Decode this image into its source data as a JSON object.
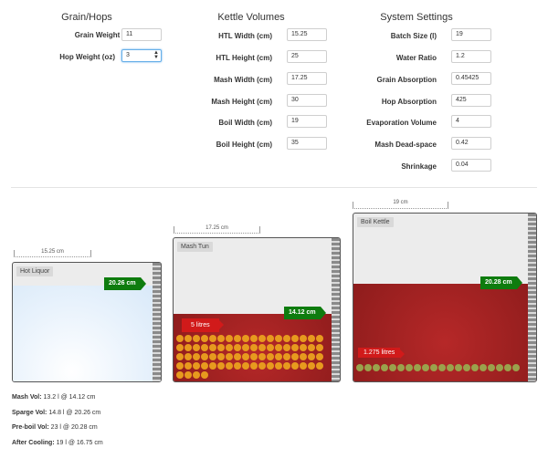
{
  "grain_hops": {
    "title": "Grain/Hops",
    "fields": [
      {
        "label": "Grain Weight (lb)",
        "value": "11"
      },
      {
        "label": "Hop Weight (oz)",
        "value": "3"
      }
    ]
  },
  "kettle_volumes": {
    "title": "Kettle Volumes",
    "fields": [
      {
        "label": "HTL Width (cm)",
        "value": "15.25"
      },
      {
        "label": "HTL Height (cm)",
        "value": "25"
      },
      {
        "label": "Mash Width (cm)",
        "value": "17.25"
      },
      {
        "label": "Mash Height (cm)",
        "value": "30"
      },
      {
        "label": "Boil Width (cm)",
        "value": "19"
      },
      {
        "label": "Boil Height (cm)",
        "value": "35"
      }
    ]
  },
  "system_settings": {
    "title": "System Settings",
    "fields": [
      {
        "label": "Batch Size (l)",
        "value": "19"
      },
      {
        "label": "Water Ratio",
        "value": "1.2"
      },
      {
        "label": "Grain Absorption",
        "value": "0.45425"
      },
      {
        "label": "Hop Absorption",
        "value": "425"
      },
      {
        "label": "Evaporation Volume",
        "value": "4"
      },
      {
        "label": "Mash Dead-space",
        "value": "0.42"
      },
      {
        "label": "Shrinkage",
        "value": "0.04"
      }
    ]
  },
  "kettles": {
    "hot_liquor": {
      "label": "Hot Liquor",
      "width_text": "15.25 cm",
      "level_text": "20.26 cm",
      "fill_fraction": 0.81
    },
    "mash_tun": {
      "label": "Mash Tun",
      "width_text": "17.25 cm",
      "level_text": "14.12 cm",
      "volume_tag": "5 litres",
      "fill_fraction": 0.47
    },
    "boil_kettle": {
      "label": "Boil Kettle",
      "width_text": "19 cm",
      "level_text": "20.28 cm",
      "volume_tag": "1.275 litres",
      "fill_fraction": 0.58
    }
  },
  "summary": [
    {
      "label": "Mash Vol:",
      "value": "13.2 l @ 14.12 cm"
    },
    {
      "label": "Sparge Vol:",
      "value": "14.8 l @ 20.26 cm"
    },
    {
      "label": "Pre-boil Vol:",
      "value": "23 l @ 20.28 cm"
    },
    {
      "label": "After Cooling:",
      "value": "19 l @ 16.75 cm"
    }
  ],
  "colors": {
    "accent_green": "#0e7c0e",
    "wort_red": "#8e1c1c",
    "tag_red": "#d11a1a",
    "grain": "#e79a1e",
    "hop": "#9aa24c"
  }
}
